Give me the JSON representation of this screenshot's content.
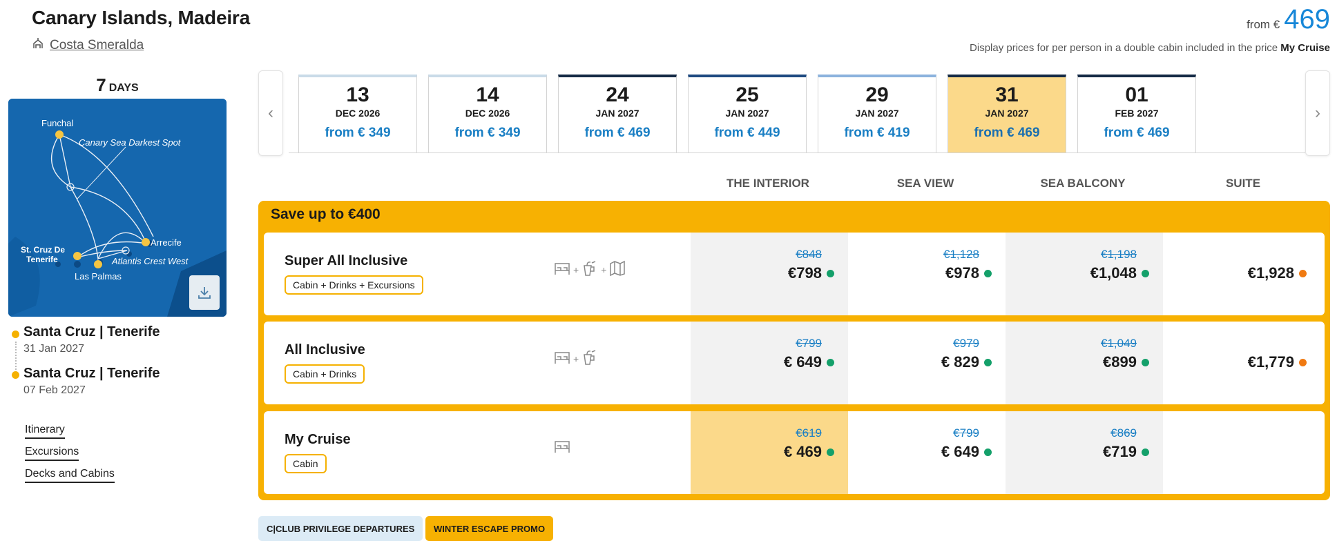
{
  "header": {
    "title": "Canary Islands, Madeira",
    "ship": "Costa Smeralda",
    "from_label": "from €",
    "from_value": "469",
    "note_prefix": "Display prices for per person in a double cabin included in the price",
    "note_bold": "My Cruise"
  },
  "sidebar": {
    "days_num": "7",
    "days_label": "DAYS",
    "map_labels": {
      "funchal": "Funchal",
      "canary_spot": "Canary Sea Darkest Spot",
      "arrecife": "Arrecife",
      "st_cruz_1": "St. Cruz De",
      "st_cruz_2": "Tenerife",
      "atlantis": "Atlantis Crest West",
      "las_palmas": "Las Palmas"
    },
    "departure": {
      "port": "Santa Cruz | Tenerife",
      "date": "31 Jan 2027"
    },
    "arrival": {
      "port": "Santa Cruz | Tenerife",
      "date": "07 Feb 2027"
    },
    "links": [
      "Itinerary",
      "Excursions",
      "Decks and Cabins"
    ]
  },
  "dates": [
    {
      "day": "13",
      "month": "DEC 2026",
      "price": "from € 349",
      "accent": "#c9dbe8"
    },
    {
      "day": "14",
      "month": "DEC 2026",
      "price": "from € 349",
      "accent": "#c9dbe8"
    },
    {
      "day": "24",
      "month": "JAN 2027",
      "price": "from € 469",
      "accent": "#152a45"
    },
    {
      "day": "25",
      "month": "JAN 2027",
      "price": "from € 449",
      "accent": "#1e4a80"
    },
    {
      "day": "29",
      "month": "JAN 2027",
      "price": "from € 419",
      "accent": "#8bb2dd"
    },
    {
      "day": "31",
      "month": "JAN 2027",
      "price": "from € 469",
      "accent": "#152a45"
    },
    {
      "day": "01",
      "month": "FEB 2027",
      "price": "from € 469",
      "accent": "#152a45"
    }
  ],
  "cabins": [
    "THE INTERIOR",
    "SEA VIEW",
    "SEA BALCONY",
    "SUITE"
  ],
  "promo": {
    "title": "Save up to €400",
    "fares": [
      {
        "name": "Super All Inclusive",
        "tag": "Cabin + Drinks + Excursions",
        "prices": [
          {
            "old": "€848",
            "new": "€798",
            "dot": "green"
          },
          {
            "old": "€1,128",
            "new": "€978",
            "dot": "green"
          },
          {
            "old": "€1,198",
            "new": "€1,048",
            "dot": "green"
          },
          {
            "old": "",
            "new": "€1,928",
            "dot": "orange"
          }
        ]
      },
      {
        "name": "All Inclusive",
        "tag": "Cabin + Drinks",
        "prices": [
          {
            "old": "€799",
            "new": "€ 649",
            "dot": "green"
          },
          {
            "old": "€979",
            "new": "€ 829",
            "dot": "green"
          },
          {
            "old": "€1,049",
            "new": "€899",
            "dot": "green"
          },
          {
            "old": "",
            "new": "€1,779",
            "dot": "orange"
          }
        ]
      },
      {
        "name": "My Cruise",
        "tag": "Cabin",
        "prices": [
          {
            "old": "€619",
            "new": "€ 469",
            "dot": "green"
          },
          {
            "old": "€799",
            "new": "€ 649",
            "dot": "green"
          },
          {
            "old": "€869",
            "new": "€719",
            "dot": "green"
          }
        ]
      }
    ]
  },
  "badges": [
    "C|CLUB PRIVILEGE DEPARTURES",
    "WINTER ESCAPE PROMO"
  ],
  "colors": {
    "accent": "#f7b102",
    "price_blue": "#1a7fc4",
    "available": "#14a06a",
    "limited": "#f07a12"
  }
}
